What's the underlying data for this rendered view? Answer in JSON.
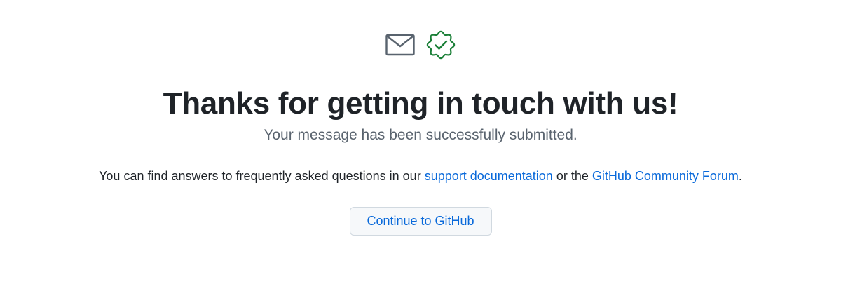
{
  "icons": {
    "mail": "mail-icon",
    "verified": "verified-check-icon"
  },
  "content": {
    "title": "Thanks for getting in touch with us!",
    "subtitle": "Your message has been successfully submitted.",
    "info_prefix": "You can find answers to frequently asked questions in our ",
    "support_link": "support documentation",
    "info_middle": " or the ",
    "forum_link": "GitHub Community Forum",
    "info_suffix": "."
  },
  "actions": {
    "continue_label": "Continue to GitHub"
  },
  "colors": {
    "text": "#1f2328",
    "muted": "#59636e",
    "link": "#0969da",
    "success": "#1a7f37",
    "icon_gray": "#59636e",
    "button_bg": "#f6f8fa",
    "button_border": "#d1d9e0"
  }
}
